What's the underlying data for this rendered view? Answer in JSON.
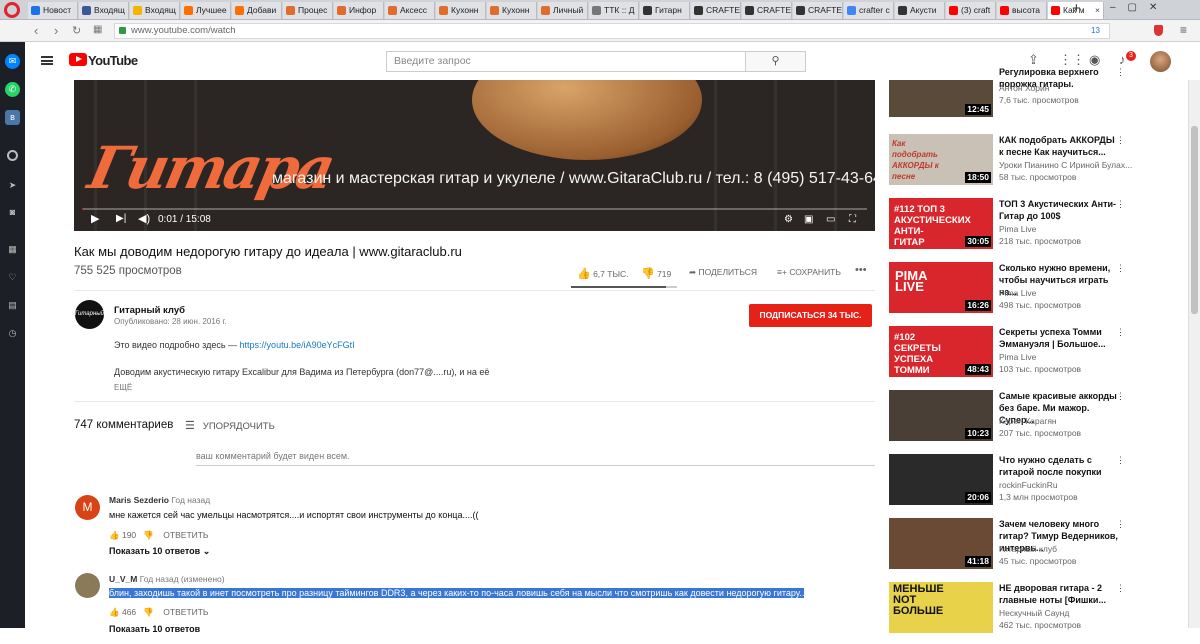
{
  "browser": {
    "tabs": [
      {
        "label": "Новост",
        "color": "#1a73e8"
      },
      {
        "label": "Входящ",
        "color": "#3b5998"
      },
      {
        "label": "Входящ",
        "color": "#f5b400"
      },
      {
        "label": "Лучшее",
        "color": "#ff6f00"
      },
      {
        "label": "Добави",
        "color": "#ff6f00"
      },
      {
        "label": "Процес",
        "color": "#e06c2d"
      },
      {
        "label": "Инфор",
        "color": "#e06c2d"
      },
      {
        "label": "Аксесс",
        "color": "#e06c2d"
      },
      {
        "label": "Кухонн",
        "color": "#e06c2d"
      },
      {
        "label": "Кухонн",
        "color": "#e06c2d"
      },
      {
        "label": "Личный",
        "color": "#e06c2d"
      },
      {
        "label": "ТТК :: Д",
        "color": "#777"
      },
      {
        "label": "Гитарн",
        "color": "#333"
      },
      {
        "label": "CRAFTE",
        "color": "#333"
      },
      {
        "label": "CRAFTE",
        "color": "#333"
      },
      {
        "label": "CRAFTE",
        "color": "#333"
      },
      {
        "label": "crafter c",
        "color": "#4285f4"
      },
      {
        "label": "Акусти",
        "color": "#333"
      },
      {
        "label": "(3) craft",
        "color": "#f00"
      },
      {
        "label": "высота",
        "color": "#f00"
      },
      {
        "label": "Как м",
        "color": "#f00"
      }
    ],
    "url": "www.youtube.com/watch",
    "badge_count": "13",
    "new_tab_symbol": "+"
  },
  "youtube": {
    "logo_text": "YouTube",
    "search_placeholder": "Введите запрос",
    "notification_count": "3"
  },
  "video": {
    "overlay_text": "магазин и мастерская гитар и укулеле / www.GitaraClub.ru / тел.: 8 (495) 517-43-64",
    "overlay_logo": "Гитара",
    "time": "0:01 / 15:08",
    "progress": 0.001,
    "title": "Как мы доводим недорогую гитару до идеала | www.gitaraclub.ru",
    "views": "755 525 просмотров",
    "likes": "6,7 ТЫС.",
    "dislikes": "719",
    "like_ratio": 0.9,
    "share": "ПОДЕЛИТЬСЯ",
    "save": "СОХРАНИТЬ"
  },
  "channel": {
    "name": "Гитарный клуб",
    "avatar_text": "Гитарный Клуб",
    "published": "Опубликовано: 28 июн. 2016 г.",
    "subscribe": "ПОДПИСАТЬСЯ",
    "subscribers": "34 ТЫС.",
    "desc_line1": "Это видео подробно здесь —",
    "desc_link": "https://youtu.be/iA90eYcFGtI",
    "desc_line2": "Доводим акустическую гитару Excalibur для Вадима из Петербурга (don77@....ru), и на её",
    "more": "ЕЩЁ"
  },
  "comments": {
    "count": "747 комментариев",
    "sort": "УПОРЯДОЧИТЬ",
    "input_placeholder": "ваш комментарий будет виден всем.",
    "items": [
      {
        "avatar": "M",
        "avatar_color": "#d84315",
        "author": "Maris Sezderio",
        "time": "Год назад",
        "text": "мне кажется сей час умельцы насмотрятся....и испортят свои инструменты до конца....((",
        "likes": "190",
        "reply": "ОТВЕТИТЬ",
        "show_replies": "Показать 10 ответов"
      },
      {
        "avatar": "",
        "avatar_color": "#8a7a5a",
        "author": "U_V_M",
        "time": "Год назад (изменено)",
        "text": "блин, заходишь такой в инет посмотреть про разницу таймингов DDR3, а через каких-то по-часа ловишь себя на мысли что смотришь как довести недорогую гитару..",
        "likes": "466",
        "reply": "ОТВЕТИТЬ",
        "show_replies": "Показать 10 ответов"
      }
    ]
  },
  "related": [
    {
      "title": "Регулировка верхнего порожка гитары.",
      "channel": "Антон Хорин",
      "views": "7,6 тыс. просмотров",
      "duration": "12:45",
      "thumb_text": "",
      "thumb_bg": "#5a4a3a"
    },
    {
      "title": "КАК подобрать АККОРДЫ к песне Как научиться...",
      "channel": "Уроки Пианино С Ириной Булах...",
      "views": "58 тыс. просмотров",
      "duration": "18:50",
      "thumb_text": "Как подобрать АККОРДЫ к песне",
      "thumb_bg": "#c9c0b6"
    },
    {
      "title": "ТОП 3 Акустических Анти-Гитар до 100$",
      "channel": "Pima Live",
      "views": "218 тыс. просмотров",
      "duration": "30:05",
      "thumb_text": "#112 ТОП 3 АКУСТИЧЕСКИХ АНТИ-ГИТАР",
      "thumb_bg": "#d8262c"
    },
    {
      "title": "Сколько нужно времени, чтобы научиться играть на...",
      "channel": "Pima Live",
      "views": "498 тыс. просмотров",
      "duration": "16:26",
      "thumb_text": "PIMA LIVE",
      "thumb_bg": "#d8262c"
    },
    {
      "title": "Секреты успеха Томми Эммануэля | Большое...",
      "channel": "Pima Live",
      "views": "103 тыс. просмотров",
      "duration": "48:43",
      "thumb_text": "#102 СЕКРЕТЫ УСПЕХА ТОММИ ЭММАНУЭЛЯ",
      "thumb_bg": "#d8262c"
    },
    {
      "title": "Самые красивые аккорды без баре. Ми мажор. Супер...",
      "channel": "Карен Карагян",
      "views": "207 тыс. просмотров",
      "duration": "10:23",
      "thumb_text": "",
      "thumb_bg": "#4a3f36"
    },
    {
      "title": "Что нужно сделать с гитарой после покупки",
      "channel": "rockinFuckinRu",
      "views": "1,3 млн просмотров",
      "duration": "20:06",
      "thumb_text": "",
      "thumb_bg": "#2a2a2a"
    },
    {
      "title": "Зачем человеку много гитар? Тимур Ведерников, интервь...",
      "channel": "Гитарный клуб",
      "views": "45 тыс. просмотров",
      "duration": "41:18",
      "thumb_text": "",
      "thumb_bg": "#6b4a35"
    },
    {
      "title": "НЕ дворовая гитара - 2 главные ноты [Фишки...",
      "channel": "Нескучный Саунд",
      "views": "462 тыс. просмотров",
      "duration": "",
      "thumb_text": "МЕНЬШЕ NOT БОЛЬШЕ",
      "thumb_bg": "#e8d24a"
    }
  ]
}
